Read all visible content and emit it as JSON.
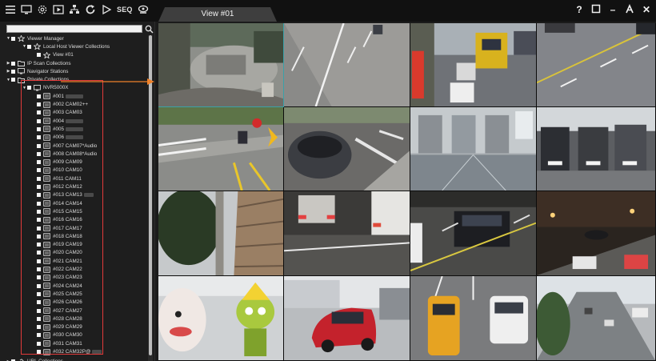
{
  "toolbar": {
    "icons": [
      "menu-icon",
      "monitor-icon",
      "settings-icon",
      "playback-icon",
      "network-icon",
      "refresh-icon",
      "play-icon",
      "seq-label",
      "camera-icon"
    ],
    "seq_label": "SEQ"
  },
  "view_tab": {
    "label": "View #01"
  },
  "window_controls": {
    "help": "?",
    "restore": "☐",
    "minimize": "–",
    "user": "ጰ",
    "close": "✕"
  },
  "tree": {
    "viewer_manager": "Viewer Manager",
    "local_host_collections": "Local Host Viewer Collections",
    "view_01": "View #01",
    "ip_scan": "IP Scan Collections",
    "navigator": "Navigator Stations",
    "private": "Private Collections",
    "nvr": "NVR5000X",
    "cameras": [
      "#001",
      "#002 CAM02++",
      "#003 CAM03",
      "#004",
      "#005",
      "#006",
      "#007 CAM07*Audio",
      "#008 CAM08*Audio",
      "#009 CAM09",
      "#010 CAM10",
      "#011 CAM11",
      "#012 CAM12",
      "#013 CAM13",
      "#014 CAM14",
      "#015 CAM15",
      "#016 CAM16",
      "#017 CAM17",
      "#018 CAM18",
      "#019 CAM19",
      "#020 CAM20",
      "#021 CAM21",
      "#022 CAM22",
      "#023 CAM23",
      "#024 CAM24",
      "#025 CAM25",
      "#026 CAM26",
      "#027 CAM27",
      "#028 CAM28",
      "#029 CAM29",
      "#030 CAM30",
      "#031 CAM31",
      "#032 CAM32P@"
    ],
    "url_collections": "URL Collections"
  },
  "colors": {
    "highlight_box": "#e23a3a",
    "drag_arrow": "#f0822a",
    "selected_tile": "#3aa1a8"
  },
  "grid": {
    "layout": "4x4",
    "tiles": [
      "camera-feed-plaza-fisheye",
      "camera-feed-street-motorcycle",
      "camera-feed-street-trucks",
      "camera-feed-road-aerial",
      "camera-feed-intersection-scooter",
      "camera-feed-parked-car",
      "camera-feed-elevator-lobby",
      "camera-feed-parking-garage",
      "camera-feed-tree-building",
      "camera-feed-night-cars",
      "camera-feed-night-sedan",
      "camera-feed-night-street",
      "camera-feed-mascot-statue",
      "camera-feed-red-suv",
      "camera-feed-taxi-overhead",
      "camera-feed-city-street"
    ]
  }
}
